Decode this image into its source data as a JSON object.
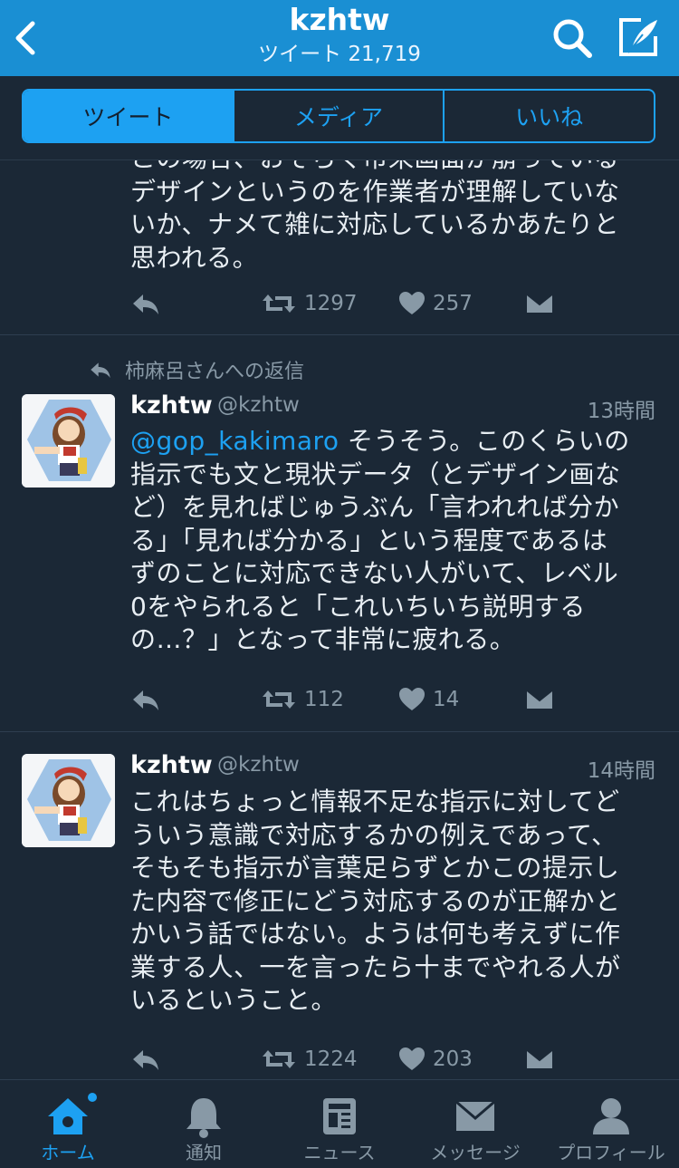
{
  "header": {
    "title": "kzhtw",
    "subtitle": "ツイート 21,719"
  },
  "tabs": [
    "ツイート",
    "メディア",
    "いいね"
  ],
  "tweets": [
    {
      "text": "この場合、おそらく市来画面が崩っている\nデザインというのを作業者が理解していな\nいか、ナメて雑に対応しているかあたりと\n思われる。",
      "retweets": "1297",
      "likes": "257"
    },
    {
      "reply_context": "柿麻呂さんへの返信",
      "name": "kzhtw",
      "handle": "@kzhtw",
      "time": "13時間",
      "mention": "@gop_kakimaro",
      "text": " そうそう。このくらいの\n指示でも文と現状データ（とデザイン画な\nど）を見ればじゅうぶん「言われれば分か\nる」「見れば分かる」という程度であるは\nずのことに対応できない人がいて、レベル\n0をやられると「これいちいち説明する\nの…？」となって非常に疲れる。",
      "retweets": "112",
      "likes": "14"
    },
    {
      "name": "kzhtw",
      "handle": "@kzhtw",
      "time": "14時間",
      "text": "これはちょっと情報不足な指示に対してど\nういう意識で対応するかの例えであって、\nそもそも指示が言葉足らずとかこの提示し\nた内容で修正にどう対応するのが正解かと\nかいう話ではない。ようは何も考えずに作\n業する人、一を言ったら十までやれる人が\nいるということ。",
      "retweets": "1224",
      "likes": "203"
    }
  ],
  "tabbar": [
    "ホーム",
    "通知",
    "ニュース",
    "メッセージ",
    "プロフィール"
  ],
  "colors": {
    "accent": "#1da1f2",
    "background": "#1b2836",
    "header": "#1a8fd3"
  }
}
